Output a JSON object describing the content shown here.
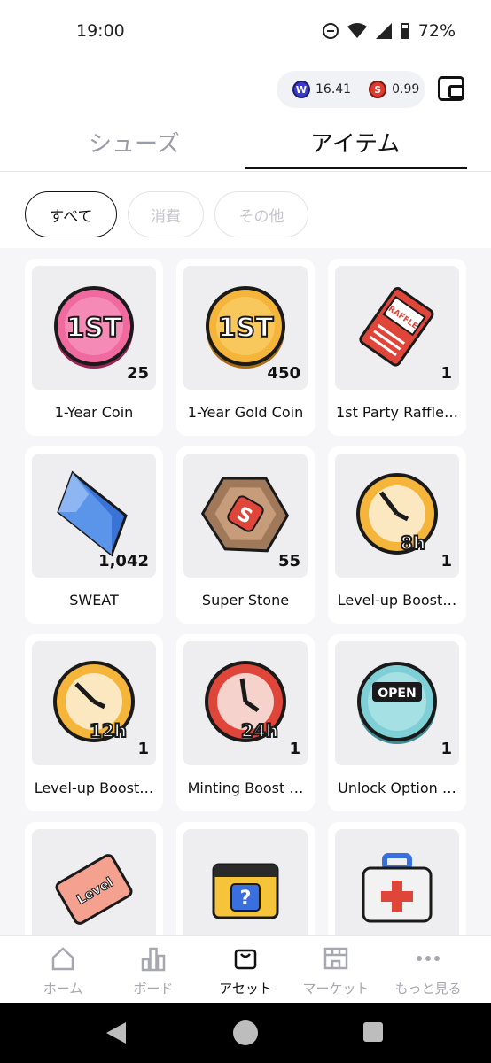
{
  "status": {
    "time": "19:00",
    "battery": "72%"
  },
  "header": {
    "balance_w": "16.41",
    "balance_s": "0.99",
    "coin_w_icon": "w-coin-icon",
    "coin_s_icon": "s-coin-icon",
    "wallet_icon": "wallet-icon"
  },
  "tabs": {
    "shoes": "シューズ",
    "items": "アイテム"
  },
  "filters": {
    "all": "すべて",
    "consumable": "消費",
    "other": "その他"
  },
  "items": [
    {
      "name": "1-Year Coin",
      "qty": "25",
      "icon": "pink-1st-coin-icon"
    },
    {
      "name": "1-Year Gold Coin",
      "qty": "450",
      "icon": "gold-1st-coin-icon"
    },
    {
      "name": "1st Party Raffle…",
      "qty": "1",
      "icon": "raffle-ticket-icon"
    },
    {
      "name": "SWEAT",
      "qty": "1,042",
      "icon": "sweat-crystal-icon"
    },
    {
      "name": "Super Stone",
      "qty": "55",
      "icon": "super-stone-icon"
    },
    {
      "name": "Level-up Boost…",
      "qty": "1",
      "icon": "boost-8h-icon"
    },
    {
      "name": "Level-up Boost…",
      "qty": "1",
      "icon": "boost-12h-icon"
    },
    {
      "name": "Minting Boost …",
      "qty": "1",
      "icon": "boost-24h-icon"
    },
    {
      "name": "Unlock Option …",
      "qty": "1",
      "icon": "open-coin-icon"
    },
    {
      "name": "",
      "qty": "",
      "icon": "level-ticket-icon"
    },
    {
      "name": "",
      "qty": "",
      "icon": "mystery-box-icon"
    },
    {
      "name": "",
      "qty": "",
      "icon": "first-aid-kit-icon"
    }
  ],
  "nav": {
    "home": "ホーム",
    "board": "ボード",
    "assets": "アセット",
    "market": "マーケット",
    "more": "もっと見る"
  },
  "colors": {
    "accent": "#111111",
    "inactive": "#a6a7b0",
    "pink": "#f06aa0",
    "gold": "#f5b43a",
    "red": "#e0453a",
    "teal": "#7fd0d6"
  }
}
